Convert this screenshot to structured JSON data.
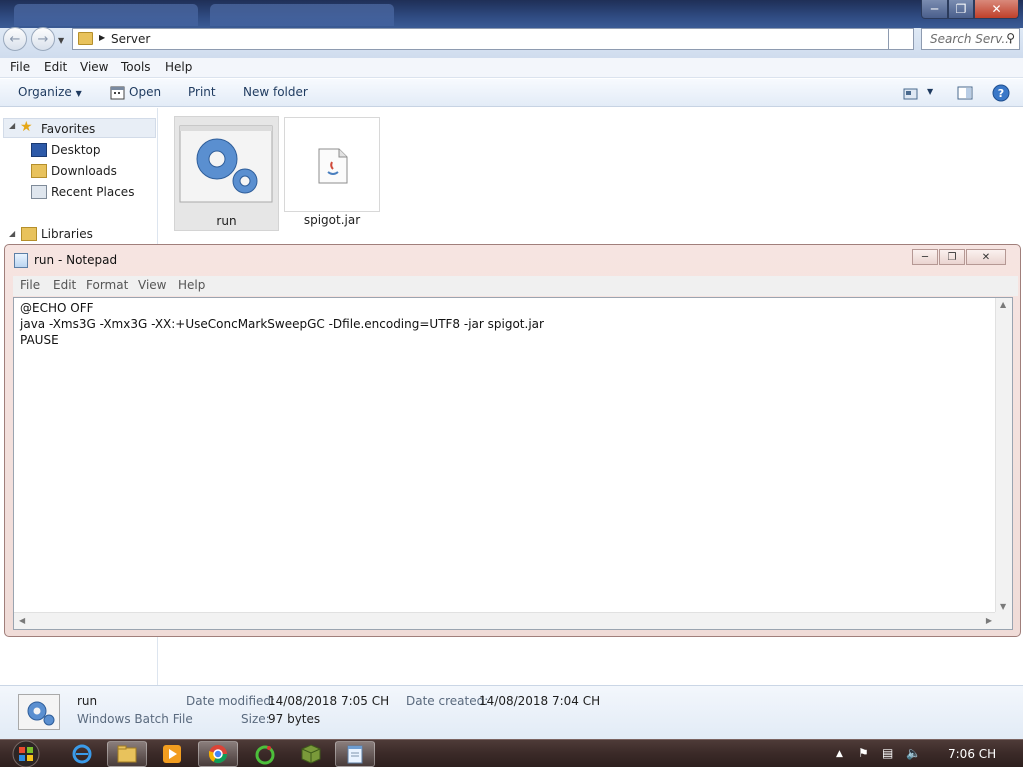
{
  "explorer": {
    "breadcrumb": "Server",
    "search_placeholder": "Search Serv...",
    "menu": [
      "File",
      "Edit",
      "View",
      "Tools",
      "Help"
    ],
    "toolbar": {
      "organize": "Organize",
      "open": "Open",
      "print": "Print",
      "new_folder": "New folder"
    },
    "nav": {
      "favorites": "Favorites",
      "desktop": "Desktop",
      "downloads": "Downloads",
      "recent_places": "Recent Places",
      "libraries": "Libraries"
    },
    "files": [
      {
        "name": "run",
        "icon": "batch-gears-icon",
        "selected": true
      },
      {
        "name": "spigot.jar",
        "icon": "java-jar-icon",
        "selected": false
      }
    ],
    "details": {
      "name": "run",
      "type": "Windows Batch File",
      "modified_label": "Date modified:",
      "modified_value": "14/08/2018 7:05 CH",
      "created_label": "Date created:",
      "created_value": "14/08/2018 7:04 CH",
      "size_label": "Size:",
      "size_value": "97 bytes"
    }
  },
  "notepad": {
    "title": "run - Notepad",
    "menu": [
      "File",
      "Edit",
      "Format",
      "View",
      "Help"
    ],
    "lines": [
      "@ECHO OFF",
      "java -Xms3G -Xmx3G -XX:+UseConcMarkSweepGC -Dfile.encoding=UTF8 -jar spigot.jar",
      "PAUSE"
    ]
  },
  "taskbar": {
    "clock": "7:06 CH",
    "apps": [
      "internet-explorer-icon",
      "file-explorer-icon",
      "media-player-icon",
      "chrome-icon",
      "ccleaner-icon",
      "minecraft-icon",
      "notepad-icon"
    ]
  },
  "colors": {
    "title_bar": "#2f4b82",
    "taskbar": "#3b2a28",
    "notepad_frame": "#f0dcd8",
    "selection": "#e6e6e6"
  }
}
